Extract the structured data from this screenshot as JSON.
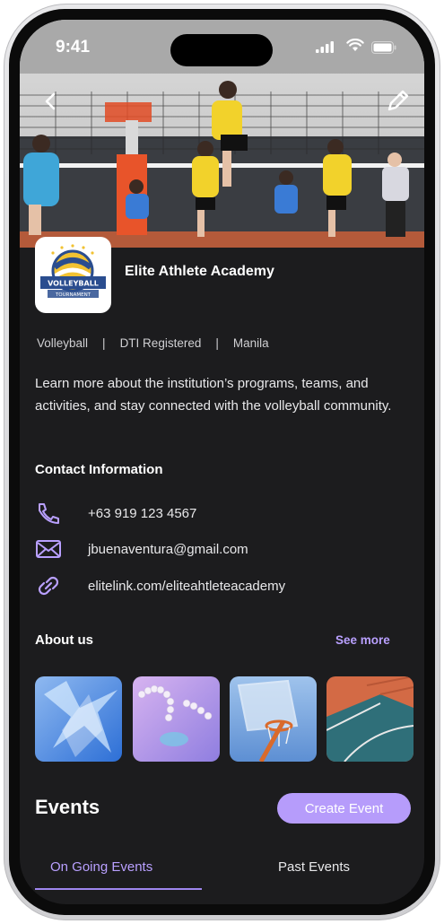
{
  "status_bar": {
    "time": "9:41"
  },
  "organization": {
    "name": "Elite Athlete Academy",
    "logo": {
      "line1": "VOLLEYBALL",
      "line2": "TOURNAMENT"
    },
    "meta": [
      "Volleyball",
      "DTI Registered",
      "Manila"
    ],
    "separator": "|",
    "description": "Learn more about the institution’s programs, teams, and activities, and stay connected with the volleyball community."
  },
  "contact": {
    "title": "Contact Information",
    "phone": "+63 919 123 4567",
    "email": "jbuenaventura@gmail.com",
    "link": "elitelink.com/eliteahtleteacademy"
  },
  "about": {
    "title": "About us",
    "see_more": "See more",
    "images": [
      "ice-crystal",
      "pearl-chain",
      "basketball-hoop",
      "basketball-court"
    ]
  },
  "events": {
    "title": "Events",
    "create_button": "Create Event",
    "tabs": [
      "On Going Events",
      "Past Events"
    ],
    "active_tab": "On Going Events"
  },
  "colors": {
    "background": "#1c1c1e",
    "accent": "#b9a0ff",
    "button": "#b69cfb"
  }
}
